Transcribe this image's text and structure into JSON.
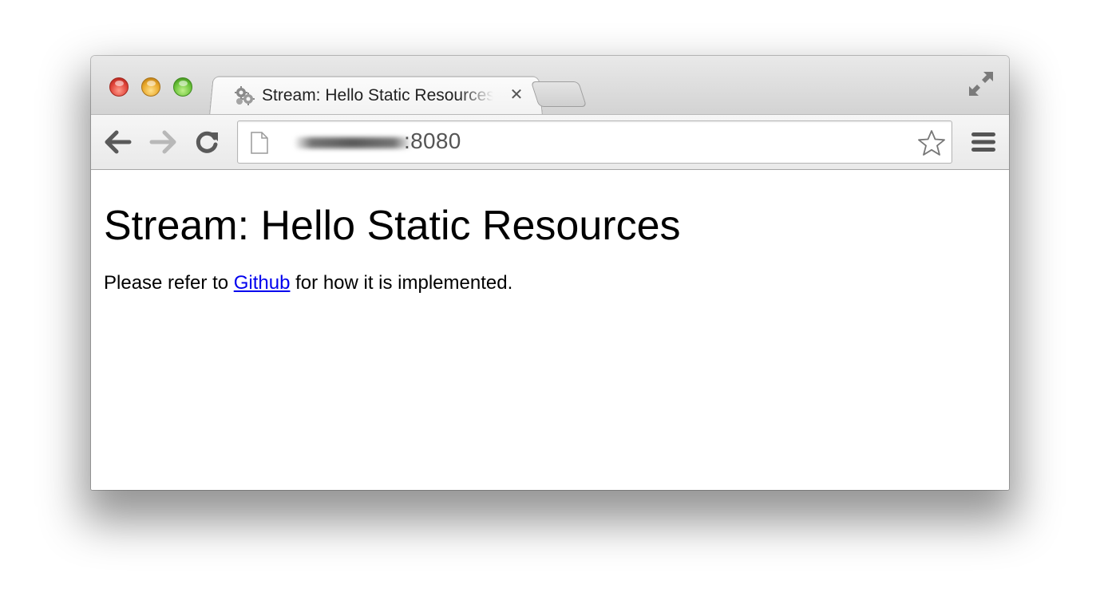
{
  "browser": {
    "tab": {
      "title": "Stream: Hello Static Resources",
      "favicon": "gear-cluster-icon"
    },
    "address_bar": {
      "url_visible": ":8080"
    },
    "icons": {
      "back": "back-arrow-icon",
      "forward": "forward-arrow-icon",
      "reload": "reload-icon",
      "bookmark": "star-icon",
      "menu": "hamburger-menu-icon",
      "fullscreen": "fullscreen-icon"
    }
  },
  "page": {
    "heading": "Stream: Hello Static Resources",
    "text_before_link": "Please refer to ",
    "link_text": "Github",
    "text_after_link": " for how it is implemented."
  },
  "colors": {
    "link": "#0000ee",
    "close_red": "#e0443a",
    "minimize_yellow": "#e9a82a",
    "zoom_green": "#6cc43a"
  }
}
